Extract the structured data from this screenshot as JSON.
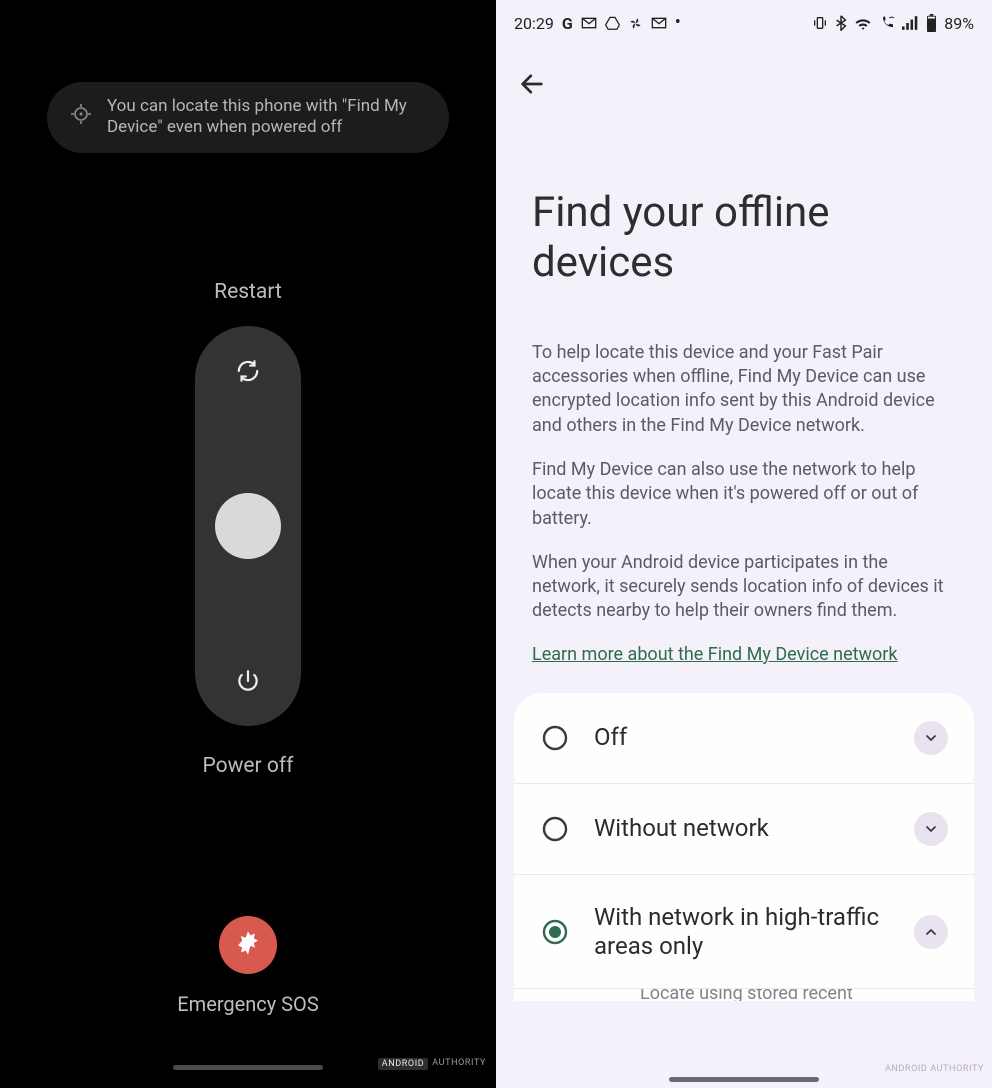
{
  "left": {
    "tip_text": "You can locate this phone with \"Find My Device\" even when powered off",
    "restart_label": "Restart",
    "poweroff_label": "Power off",
    "sos_label": "Emergency SOS",
    "watermark_a": "ANDROID",
    "watermark_b": "AUTHORITY"
  },
  "right": {
    "statusbar": {
      "time": "20:29",
      "battery_text": "89%"
    },
    "title": "Find your offline devices",
    "para1": "To help locate this device and your Fast Pair accessories when offline, Find My Device can use encrypted location info sent by this Android device and others in the Find My Device network.",
    "para2": "Find My Device can also use the network to help locate this device when it's powered off or out of battery.",
    "para3": "When your Android device participates in the network, it securely sends location info of devices it detects nearby to help their owners find them.",
    "learn_more": "Learn more about the Find My Device network",
    "options": [
      {
        "label": "Off",
        "selected": false,
        "expanded": false
      },
      {
        "label": "Without network",
        "selected": false,
        "expanded": false
      },
      {
        "label": "With network in high-traffic areas only",
        "selected": true,
        "expanded": true
      }
    ],
    "cutoff_hint": "Locate using stored recent",
    "watermark": "ANDROID AUTHORITY"
  }
}
